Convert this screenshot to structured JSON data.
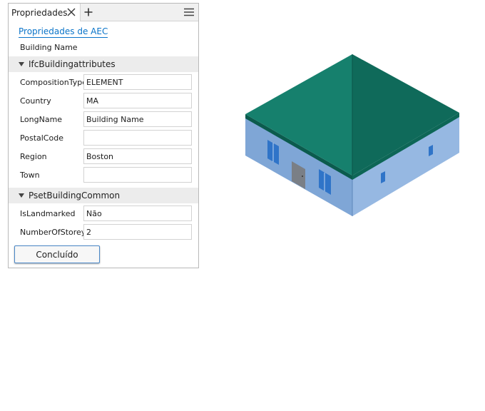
{
  "tab": {
    "title": "Propriedades"
  },
  "panel": {
    "link": "Propriedades de AEC",
    "building_name_label": "Building Name",
    "sections": [
      {
        "title": "IfcBuildingattributes",
        "properties": [
          {
            "label": "CompositionType",
            "value": "ELEMENT"
          },
          {
            "label": "Country",
            "value": "MA"
          },
          {
            "label": "LongName",
            "value": "Building Name"
          },
          {
            "label": "PostalCode",
            "value": ""
          },
          {
            "label": "Region",
            "value": "Boston"
          },
          {
            "label": "Town",
            "value": ""
          }
        ]
      },
      {
        "title": "PsetBuildingCommon",
        "properties": [
          {
            "label": "IsLandmarked",
            "value": "Não"
          },
          {
            "label": "NumberOfStoreys",
            "value": "2"
          }
        ]
      }
    ],
    "done_button": "Concluído"
  },
  "colors": {
    "roof": "#0f6e5e",
    "roof_light": "#1b8775",
    "wall_left": "#7fa6d6",
    "wall_right": "#96b8e2",
    "window": "#2f74c8",
    "door": "#7a7f86",
    "link": "#0a74c9"
  },
  "icons": {
    "close": "close-icon",
    "add": "plus-icon",
    "menu": "hamburger-menu-icon",
    "expand": "triangle-down-icon"
  }
}
